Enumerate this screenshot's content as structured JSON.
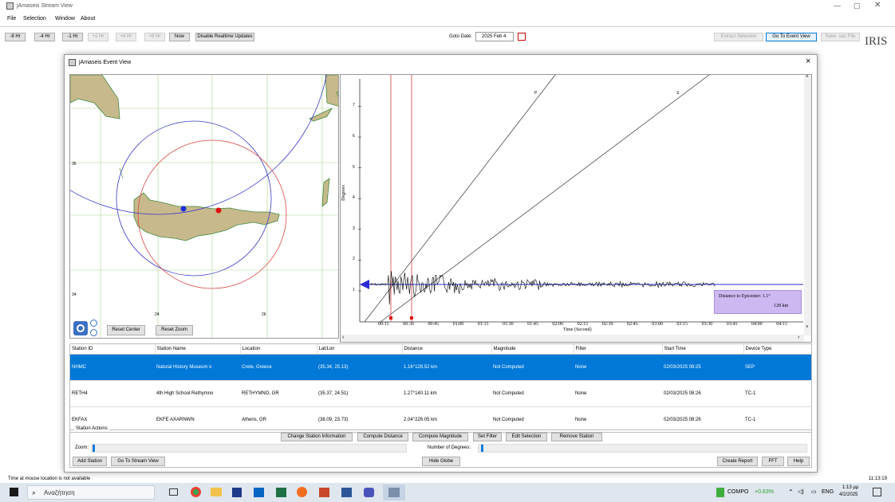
{
  "main_window": {
    "title": "jAmaseis Stream View",
    "menu": [
      "File",
      "Selection",
      "Window",
      "About"
    ]
  },
  "toolbar": {
    "buttons": [
      "-8 Hr",
      "-4 Hr",
      "-1 Hr",
      "+1 Hr",
      "+4 Hr",
      "+8 Hr",
      "Now",
      "Disable Realtime Updates"
    ],
    "goto_label": "Goto Date:",
    "goto_value": "2025 Feb 4",
    "right_buttons": [
      "Extract Selection",
      "Go To Event View",
      "Save .sac File"
    ],
    "iris_logo": "IRIS"
  },
  "event_window": {
    "title": "jAmaseis Event View",
    "close": "×"
  },
  "map": {
    "lat_labels": [
      "36",
      "34"
    ],
    "lon_labels": [
      "24",
      "26"
    ],
    "reset_center": "Reset Center",
    "reset_zoom": "Reset Zoom",
    "colors": {
      "sea": "#ffffff",
      "land": "#c8b98c",
      "land_border": "#3f8a3f"
    }
  },
  "plot": {
    "y_label": "Degrees",
    "y_ticks": [
      "1",
      "2",
      "3",
      "4",
      "5",
      "6",
      "7"
    ],
    "x_ticks": [
      "00:15",
      "00:30",
      "00:45",
      "01:00",
      "01:15",
      "01:30",
      "01:45",
      "02:00",
      "02:15",
      "02:30",
      "02:45",
      "03:00",
      "03:15",
      "03:30",
      "03:45",
      "04:00",
      "04:15"
    ],
    "x_label": "Time (Second)",
    "p_label": "P",
    "s_label": "S",
    "info_line1": "Distance to Epicenter: 1.1°",
    "info_line2": "128 km"
  },
  "table": {
    "headers": [
      "Station ID",
      "Station Name",
      "Location",
      "Lat/Lon",
      "Distance",
      "Magnitude",
      "Filter",
      "Start Time",
      "Device Type"
    ],
    "rows": [
      [
        "NHMC",
        "Natural History Museum o",
        "Crete, Greece",
        "(35.34, 25.13)",
        "1.16°128.52 km",
        "Not Computed",
        "None",
        "02/03/2025 08:25",
        "SEP"
      ],
      [
        "RETH4",
        "4th High School Rethymno",
        "RETHYMNO, GR",
        "(35.37, 24.51)",
        "1.27°140.11 km",
        "Not Computed",
        "None",
        "02/03/2025 08:26",
        "TC-1"
      ],
      [
        "EKFAX",
        "EKFE AXARNWN",
        "Athens, GR",
        "(38.09, 23.73)",
        "2.04°226.05 km",
        "Not Computed",
        "None",
        "02/03/2025 08:26",
        "TC-1"
      ]
    ]
  },
  "station_actions": {
    "title": "Station Actions",
    "buttons": [
      "Change Station Information",
      "Compute Distance",
      "Compute Magnitude",
      "Set Filter",
      "Edit Selection",
      "Remove Station"
    ],
    "zoom_label": "Zoom:",
    "degrees_label": "Number of Degrees:"
  },
  "bottom_buttons": {
    "add": "Add Station",
    "goto": "Go To Stream View",
    "hide": "Hide Globe",
    "report": "Create Report",
    "fft": "FFT",
    "help": "Help"
  },
  "status": {
    "left": "Time at mouse location is not available",
    "clock": "11:13:19"
  },
  "taskbar": {
    "search": "Αναζήτηση",
    "stock": "COMPO",
    "stock_change": "+0.63%",
    "lang": "ENG",
    "time": "1:13 μμ",
    "date": "4/2/2025"
  }
}
